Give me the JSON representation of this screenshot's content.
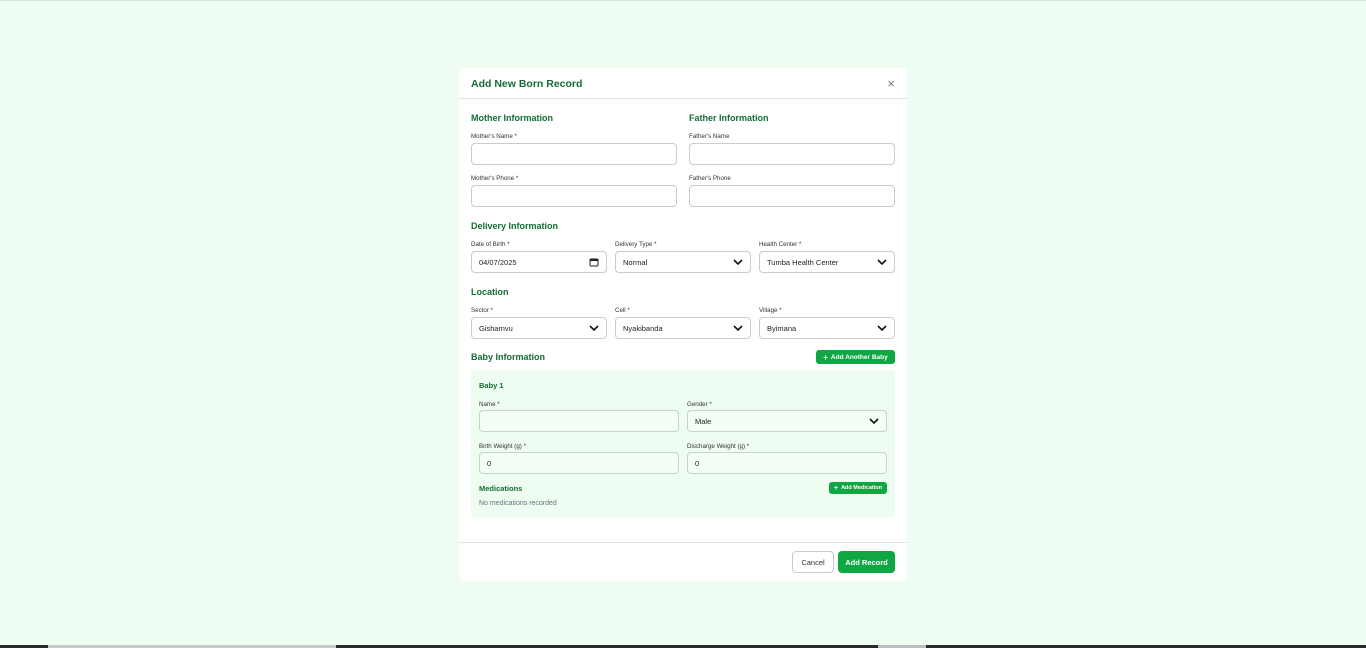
{
  "modal": {
    "title": "Add New Born Record",
    "close_icon": "×"
  },
  "mother": {
    "section_title": "Mother Information",
    "name_label": "Mother's Name *",
    "name_value": "",
    "phone_label": "Mother's Phone *",
    "phone_value": ""
  },
  "father": {
    "section_title": "Father Information",
    "name_label": "Father's Name",
    "name_value": "",
    "phone_label": "Father's Phone",
    "phone_value": ""
  },
  "delivery": {
    "section_title": "Delivery Information",
    "dob_label": "Date of Birth *",
    "dob_value": "04/07/2025",
    "type_label": "Delivery Type *",
    "type_value": "Normal",
    "center_label": "Health Center *",
    "center_value": "Tumba Health Center"
  },
  "location": {
    "section_title": "Location",
    "sector_label": "Sector *",
    "sector_value": "Gishamvu",
    "cell_label": "Cell *",
    "cell_value": "Nyakibanda",
    "village_label": "Village *",
    "village_value": "Byimana"
  },
  "baby": {
    "section_title": "Baby Information",
    "add_another_label": "Add Another Baby",
    "card_title": "Baby 1",
    "name_label": "Name *",
    "name_value": "",
    "gender_label": "Gender *",
    "gender_value": "Male",
    "birth_weight_label": "Birth Weight (g) *",
    "birth_weight_value": "0",
    "discharge_weight_label": "Discharge Weight (g) *",
    "discharge_weight_value": "0",
    "medications_title": "Medications",
    "add_medication_label": "Add Medication",
    "no_medications_text": "No medications recorded"
  },
  "footer": {
    "cancel_label": "Cancel",
    "submit_label": "Add Record"
  },
  "colors": {
    "accent": "#0ea744",
    "heading": "#146c34",
    "page_background": "#effcf1",
    "card_background": "#eefcf1"
  },
  "icons": {
    "close": "close-icon",
    "plus": "plus-icon",
    "chevron": "chevron-down-icon",
    "calendar": "calendar-icon"
  }
}
